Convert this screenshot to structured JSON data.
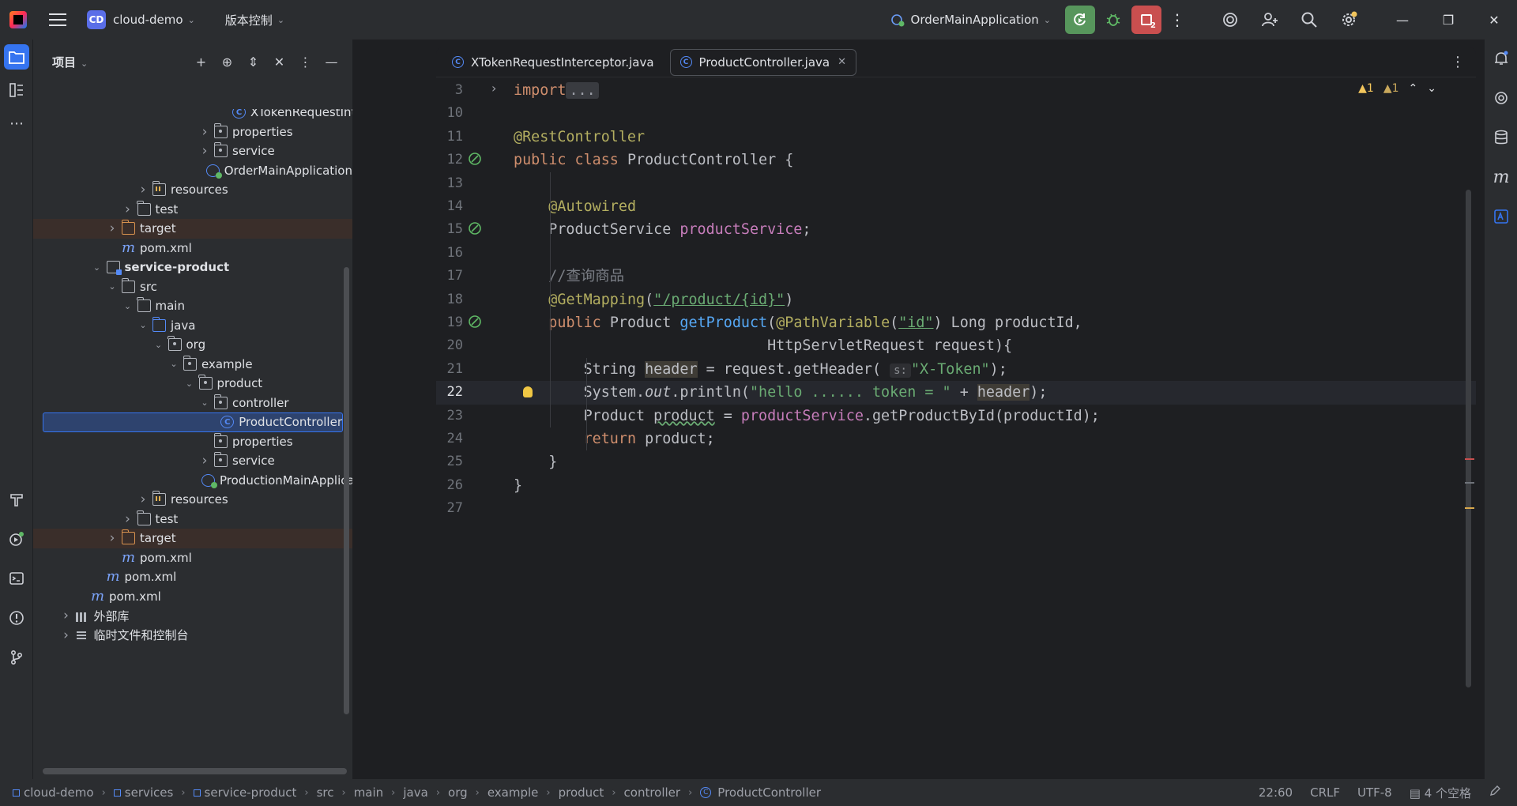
{
  "titlebar": {
    "project_badge": "CD",
    "project_name": "cloud-demo",
    "vcs_label": "版本控制",
    "run_config": "OrderMainApplication",
    "stop_count": "2"
  },
  "project_panel": {
    "title": "项目",
    "tree": [
      {
        "label": "XTokenRequestInterceptor",
        "icon": "class-icon",
        "indent": 12,
        "arrow": ""
      },
      {
        "label": "properties",
        "icon": "package-folder-icon",
        "indent": 10,
        "arrow": "collapsed"
      },
      {
        "label": "service",
        "icon": "package-folder-icon",
        "indent": 10,
        "arrow": "collapsed"
      },
      {
        "label": "OrderMainApplication",
        "icon": "spring-app-icon",
        "indent": 10,
        "arrow": ""
      },
      {
        "label": "resources",
        "icon": "resources-folder-icon",
        "indent": 6,
        "arrow": "collapsed"
      },
      {
        "label": "test",
        "icon": "folder-icon",
        "indent": 5,
        "arrow": "collapsed"
      },
      {
        "label": "target",
        "icon": "excluded-folder-icon",
        "indent": 4,
        "arrow": "collapsed",
        "excluded": true
      },
      {
        "label": "pom.xml",
        "icon": "maven-icon",
        "indent": 4,
        "arrow": ""
      },
      {
        "label": "service-product",
        "icon": "module-icon",
        "indent": 3,
        "arrow": "expanded",
        "bold": true
      },
      {
        "label": "src",
        "icon": "folder-icon",
        "indent": 4,
        "arrow": "expanded"
      },
      {
        "label": "main",
        "icon": "folder-icon",
        "indent": 5,
        "arrow": "expanded"
      },
      {
        "label": "java",
        "icon": "source-folder-icon",
        "indent": 6,
        "arrow": "expanded"
      },
      {
        "label": "org",
        "icon": "package-folder-icon",
        "indent": 7,
        "arrow": "expanded"
      },
      {
        "label": "example",
        "icon": "package-folder-icon",
        "indent": 8,
        "arrow": "expanded"
      },
      {
        "label": "product",
        "icon": "package-folder-icon",
        "indent": 9,
        "arrow": "expanded"
      },
      {
        "label": "controller",
        "icon": "package-folder-icon",
        "indent": 10,
        "arrow": "expanded"
      },
      {
        "label": "ProductController",
        "icon": "class-icon",
        "indent": 11,
        "arrow": "",
        "selected": true
      },
      {
        "label": "properties",
        "icon": "package-folder-icon",
        "indent": 10,
        "arrow": ""
      },
      {
        "label": "service",
        "icon": "package-folder-icon",
        "indent": 10,
        "arrow": "collapsed"
      },
      {
        "label": "ProductionMainApplication",
        "icon": "spring-app-icon",
        "indent": 10,
        "arrow": ""
      },
      {
        "label": "resources",
        "icon": "resources-folder-icon",
        "indent": 6,
        "arrow": "collapsed"
      },
      {
        "label": "test",
        "icon": "folder-icon",
        "indent": 5,
        "arrow": "collapsed"
      },
      {
        "label": "target",
        "icon": "excluded-folder-icon",
        "indent": 4,
        "arrow": "collapsed",
        "excluded": true
      },
      {
        "label": "pom.xml",
        "icon": "maven-icon",
        "indent": 4,
        "arrow": ""
      },
      {
        "label": "pom.xml",
        "icon": "maven-icon",
        "indent": 3,
        "arrow": ""
      },
      {
        "label": "pom.xml",
        "icon": "maven-icon",
        "indent": 2,
        "arrow": ""
      },
      {
        "label": "外部库",
        "icon": "library-icon",
        "indent": 1,
        "arrow": "collapsed"
      },
      {
        "label": "临时文件和控制台",
        "icon": "scratch-icon",
        "indent": 1,
        "arrow": "collapsed"
      }
    ]
  },
  "editor": {
    "tabs": [
      {
        "label": "XTokenRequestInterceptor.java",
        "active": false
      },
      {
        "label": "ProductController.java",
        "active": true
      }
    ],
    "warnings": "1",
    "weak_warnings": "1",
    "current_line": 22,
    "lines": [
      {
        "num": "3",
        "tokens": [
          [
            "kw",
            "import"
          ],
          [
            "",
            ""
          ],
          [
            "fold",
            "..."
          ]
        ]
      },
      {
        "num": "10",
        "tokens": []
      },
      {
        "num": "11",
        "tokens": [
          [
            "ann",
            "@RestController"
          ]
        ]
      },
      {
        "num": "12",
        "tokens": [
          [
            "kw",
            "public class "
          ],
          [
            "",
            "ProductController {"
          ]
        ]
      },
      {
        "num": "13",
        "tokens": []
      },
      {
        "num": "14",
        "tokens": [
          [
            "",
            "    "
          ],
          [
            "ann",
            "@Autowired"
          ]
        ]
      },
      {
        "num": "15",
        "tokens": [
          [
            "",
            "    ProductService "
          ],
          [
            "fld",
            "productService"
          ],
          [
            "",
            ";"
          ]
        ]
      },
      {
        "num": "16",
        "tokens": []
      },
      {
        "num": "17",
        "tokens": [
          [
            "",
            "    "
          ],
          [
            "cmt",
            "//查询商品"
          ]
        ]
      },
      {
        "num": "18",
        "tokens": [
          [
            "",
            "    "
          ],
          [
            "ann",
            "@GetMapping"
          ],
          [
            "",
            "("
          ],
          [
            "str",
            "\"/product/{id}\""
          ],
          [
            "",
            ")"
          ]
        ]
      },
      {
        "num": "19",
        "tokens": [
          [
            "",
            "    "
          ],
          [
            "kw",
            "public "
          ],
          [
            "",
            "Product "
          ],
          [
            "fn",
            "getProduct"
          ],
          [
            "",
            "("
          ],
          [
            "ann",
            "@PathVariable"
          ],
          [
            "",
            "("
          ],
          [
            "str",
            "\"id\""
          ],
          [
            "",
            ") Long productId,"
          ]
        ]
      },
      {
        "num": "20",
        "tokens": [
          [
            "",
            "                             HttpServletRequest request){"
          ]
        ]
      },
      {
        "num": "21",
        "tokens": [
          [
            "",
            "        String "
          ],
          [
            "hl",
            "header"
          ],
          [
            "",
            " = request.getHeader( "
          ],
          [
            "hint",
            "s:"
          ],
          [
            "str",
            "\"X-Token\""
          ],
          [
            "",
            ");"
          ]
        ]
      },
      {
        "num": "22",
        "tokens": [
          [
            "",
            "        System."
          ],
          [
            "fldi",
            "out"
          ],
          [
            "",
            ".println("
          ],
          [
            "str",
            "\"hello ...... token = \""
          ],
          [
            "",
            " + "
          ],
          [
            "hl",
            "header"
          ],
          [
            "",
            ");"
          ]
        ]
      },
      {
        "num": "23",
        "tokens": [
          [
            "",
            "        Product "
          ],
          [
            "wavy",
            "product"
          ],
          [
            "",
            " = "
          ],
          [
            "fld",
            "productService"
          ],
          [
            "",
            ".getProductById(productId);"
          ]
        ]
      },
      {
        "num": "24",
        "tokens": [
          [
            "",
            "        "
          ],
          [
            "kw",
            "return "
          ],
          [
            "",
            "product;"
          ]
        ]
      },
      {
        "num": "25",
        "tokens": [
          [
            "",
            "    }"
          ]
        ]
      },
      {
        "num": "26",
        "tokens": [
          [
            "",
            "}"
          ]
        ]
      },
      {
        "num": "27",
        "tokens": []
      }
    ]
  },
  "statusbar": {
    "breadcrumbs": [
      "cloud-demo",
      "services",
      "service-product",
      "src",
      "main",
      "java",
      "org",
      "example",
      "product",
      "controller",
      "ProductController"
    ],
    "position": "22:60",
    "line_sep": "CRLF",
    "encoding": "UTF-8",
    "indent": "4 个空格"
  }
}
